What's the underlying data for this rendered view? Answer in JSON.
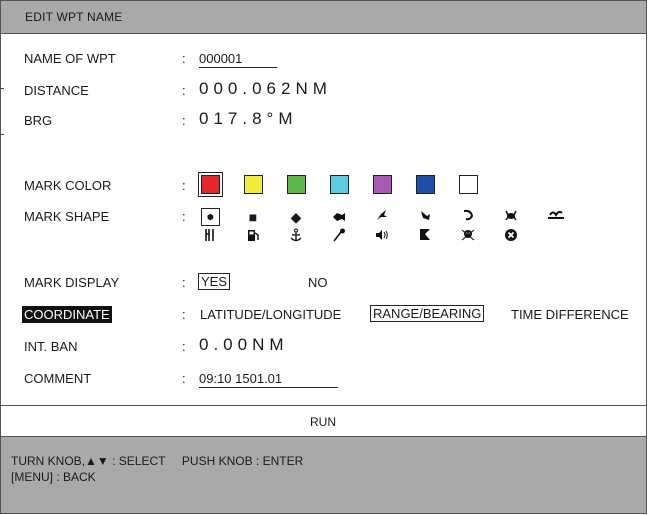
{
  "title": "EDIT WPT NAME",
  "colon": ":",
  "fields": {
    "name_label": "NAME OF WPT",
    "name_value": "000001",
    "distance_label": "DISTANCE",
    "distance_value": "000.062NM",
    "brg_label": "BRG",
    "brg_value": "017.8°M",
    "mark_color_label": "MARK COLOR",
    "mark_shape_label": "MARK SHAPE",
    "mark_display_label": "MARK DISPLAY",
    "mark_display_yes": "YES",
    "mark_display_no": "NO",
    "coordinate_label": "COORDINATE",
    "coord_latlon": "LATITUDE/LONGITUDE",
    "coord_range": "RANGE/BEARING",
    "coord_td": "TIME DIFFERENCE",
    "int_ban_label": "INT. BAN",
    "int_ban_value": "0.00NM",
    "comment_label": "COMMENT",
    "comment_value": "09:10 1501.01"
  },
  "mark_colors": [
    "#e8262a",
    "#f2ec3c",
    "#5cb947",
    "#5dcce0",
    "#a95ab4",
    "#1f50a8",
    "#ffffff"
  ],
  "mark_color_selected": "#e8262a",
  "mark_shapes_row1": [
    "●",
    "■",
    "◆",
    "fish-icon",
    "fish2-icon",
    "bird-icon",
    "shrimp-icon",
    "crab-icon",
    "wave-icon"
  ],
  "mark_shapes_row2": [
    "fork-icon",
    "fuel-icon",
    "anchor-icon",
    "pin-icon",
    "speaker-icon",
    "flag-icon",
    "skull-icon",
    "x-circle-icon"
  ],
  "run_label": "RUN",
  "footer": {
    "line1": "TURN KNOB,▲▼ : SELECT     PUSH KNOB : ENTER",
    "line2": "[MENU] : BACK"
  }
}
